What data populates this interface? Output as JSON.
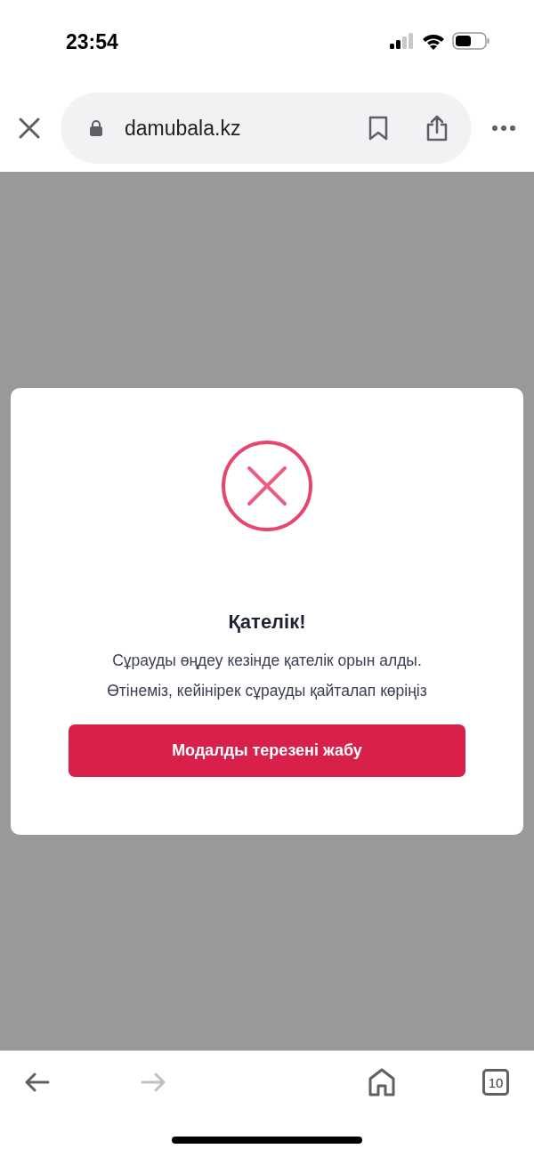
{
  "status_bar": {
    "time": "23:54"
  },
  "browser_bar": {
    "url": "damubala.kz"
  },
  "modal": {
    "title": "Қателік!",
    "message_lines": [
      "Сұрауды өңдеу кезінде қателік орын алды.",
      "Өтінеміз, кейінірек сұрауды қайталап көріңіз"
    ],
    "button": "Модалды терезені жабу"
  },
  "bottom_toolbar": {
    "back": {
      "disabled": false
    },
    "forward": {
      "disabled": true
    },
    "tab_count": "10"
  }
}
